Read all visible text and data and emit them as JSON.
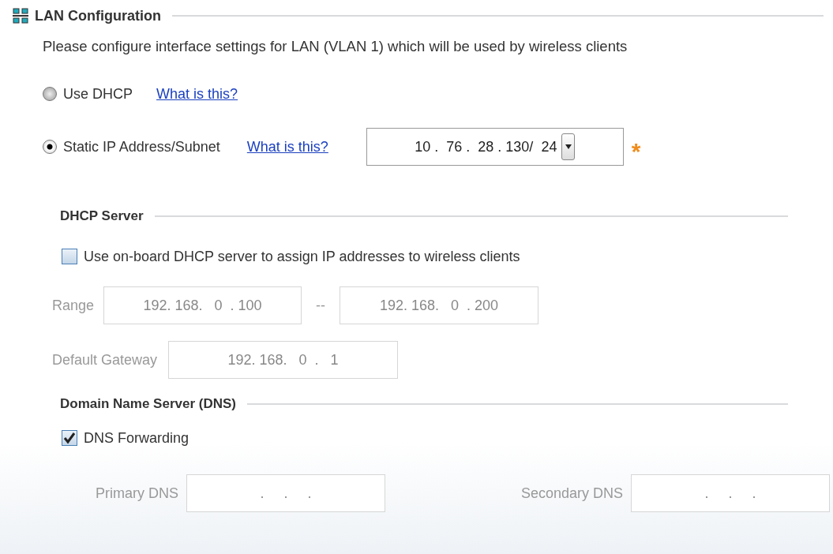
{
  "section": {
    "title": "LAN Configuration",
    "description": "Please configure interface settings for LAN (VLAN 1) which will be used by wireless clients"
  },
  "modes": [
    {
      "label": "Use DHCP",
      "selected": false,
      "help": "What is this?"
    },
    {
      "label": "Static IP Address/Subnet",
      "selected": true,
      "help": "What is this?",
      "value": "10 .  76 .  28 . 130/  24",
      "required": "*"
    }
  ],
  "dhcp_server": {
    "title": "DHCP Server",
    "checkbox": {
      "label": "Use on-board DHCP server to assign IP addresses to wireless clients",
      "checked": false
    },
    "range": {
      "label": "Range",
      "start": "192. 168.   0  . 100",
      "separator": "--",
      "end": "192. 168.   0  . 200",
      "disabled": true
    },
    "gateway": {
      "label": "Default Gateway",
      "value": "192. 168.   0  .   1",
      "disabled": true
    }
  },
  "dns": {
    "title": "Domain Name Server (DNS)",
    "checkbox": {
      "label": "DNS Forwarding",
      "checked": true
    },
    "fields": [
      {
        "label": "Primary DNS",
        "value": ".     .     .",
        "disabled": true
      },
      {
        "label": "Secondary DNS",
        "value": ".     .     .",
        "disabled": true
      }
    ]
  }
}
